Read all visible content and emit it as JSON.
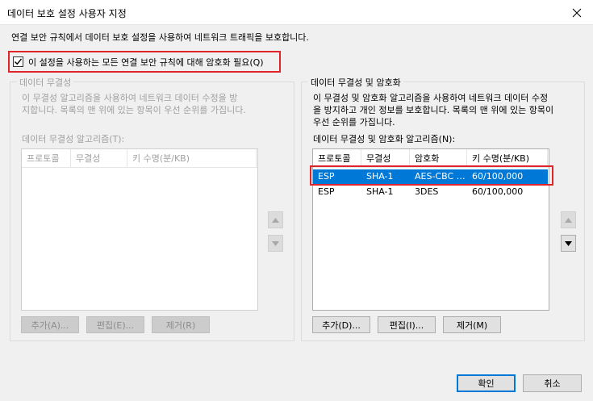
{
  "window": {
    "title": "데이터 보호 설정 사용자 지정",
    "close_icon": "close-icon"
  },
  "description": "연결 보안 규칙에서 데이터 보호 설정을 사용하여 네트워크 트래픽을 보호합니다.",
  "require_encryption": {
    "label": "이 설정을 사용하는 모든 연결 보안 규칙에 대해 암호화 필요(Q)",
    "checked": true
  },
  "integrity_group": {
    "title": "데이터 무결성",
    "text_line1": "이 무결성 알고리즘을 사용하여 네트워크 데이터 수정을 방",
    "text_line2": "지합니다. 목록의 맨 위에 있는 항목이 우선 순위를 가집니다.",
    "list_label": "데이터 무결성 알고리즘(T):",
    "columns": [
      "프로토콜",
      "무결성",
      "키 수명(분/KB)"
    ],
    "buttons": {
      "add": "추가(A)...",
      "edit": "편집(E)...",
      "remove": "제거(R)"
    }
  },
  "encryption_group": {
    "title": "데이터 무결성 및 암호화",
    "text_line1": "이 무결성 및 암호화 알고리즘을 사용하여 네트워크 데이터 수정",
    "text_line2": "을 방지하고 개인 정보를 보호합니다. 목록의 맨 위에 있는 항목이",
    "text_line3": "우선 순위를 가집니다.",
    "list_label": "데이터 무결성 및 암호화 알고리즘(N):",
    "columns": [
      "프로토콜",
      "무결성",
      "암호화",
      "키 수명(분/KB)"
    ],
    "rows": [
      {
        "protocol": "ESP",
        "integrity": "SHA-1",
        "encryption": "AES-CBC 256",
        "lifetime": "60/100,000",
        "selected": true
      },
      {
        "protocol": "ESP",
        "integrity": "SHA-1",
        "encryption": "3DES",
        "lifetime": "60/100,000",
        "selected": false
      }
    ],
    "buttons": {
      "add": "추가(D)...",
      "edit": "편집(I)...",
      "remove": "제거(M)"
    }
  },
  "footer": {
    "ok": "확인",
    "cancel": "취소"
  },
  "colors": {
    "highlight": "#e0242b",
    "selection": "#0078d7"
  }
}
